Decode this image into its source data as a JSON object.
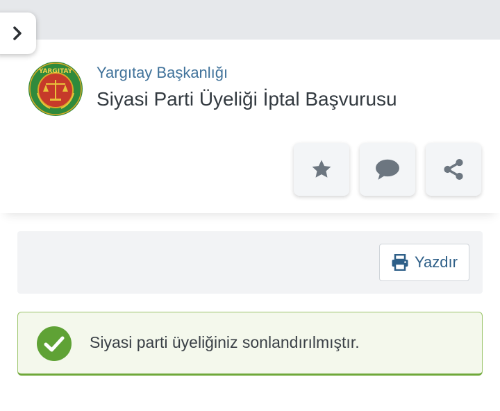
{
  "header": {
    "institution": "Yargıtay Başkanlığı",
    "service_title": "Siyasi Parti Üyeliği İptal Başvurusu",
    "logo": {
      "icon": "yargitay-seal-icon",
      "text": "YARGITAY",
      "colors": {
        "ring": "#2f8a3c",
        "center": "#c63a2a",
        "gold": "#d9a928"
      }
    }
  },
  "actions": [
    {
      "icon": "star-icon",
      "name": "favorite"
    },
    {
      "icon": "comment-icon",
      "name": "comment"
    },
    {
      "icon": "share-icon",
      "name": "share"
    }
  ],
  "toolbar": {
    "print_label": "Yazdır",
    "print_icon": "printer-icon"
  },
  "alert": {
    "type": "success",
    "icon": "check-circle-icon",
    "message": "Siyasi parti üyeliğiniz sonlandırılmıştır."
  },
  "colors": {
    "accent": "#40729a",
    "success": "#5fa235",
    "icon_gray": "#6c7680"
  }
}
